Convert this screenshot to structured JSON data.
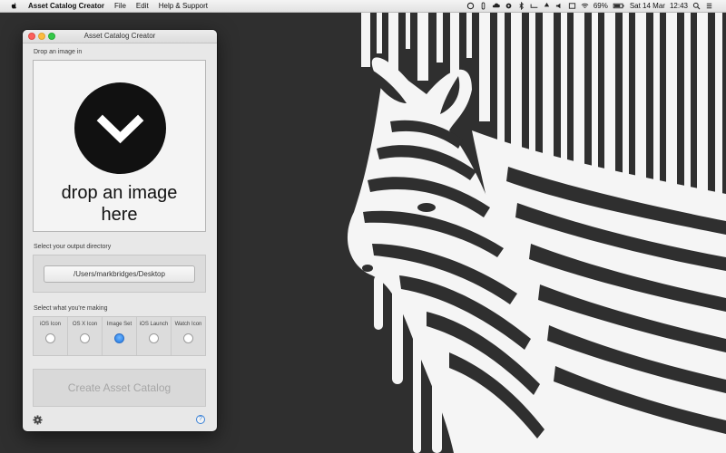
{
  "menubar": {
    "app_name": "Asset Catalog Creator",
    "menus": [
      "File",
      "Edit",
      "Help & Support"
    ],
    "status_icons": [
      "sync-icon",
      "info-icon",
      "cloud-icon",
      "gear-icon",
      "bluetooth-icon",
      "wifi-icon",
      "share-icon",
      "volume-icon"
    ],
    "battery": "69%",
    "date": "Sat 14 Mar",
    "time": "12:43"
  },
  "window": {
    "title": "Asset Catalog Creator",
    "drop_label": "Drop an image in",
    "drop_text": "drop an image here",
    "output_label": "Select your output directory",
    "output_path": "/Users/markbridges/Desktop",
    "type_label": "Select what you're making",
    "types": [
      {
        "label": "iOS Icon",
        "selected": false
      },
      {
        "label": "OS X Icon",
        "selected": false
      },
      {
        "label": "Image Set",
        "selected": true
      },
      {
        "label": "iOS Launch",
        "selected": false
      },
      {
        "label": "Watch Icon",
        "selected": false
      }
    ],
    "create_button": "Create Asset Catalog",
    "help_glyph": "?"
  },
  "colors": {
    "desktop_bg": "#2f2f2f",
    "accent": "#1f76e0"
  }
}
